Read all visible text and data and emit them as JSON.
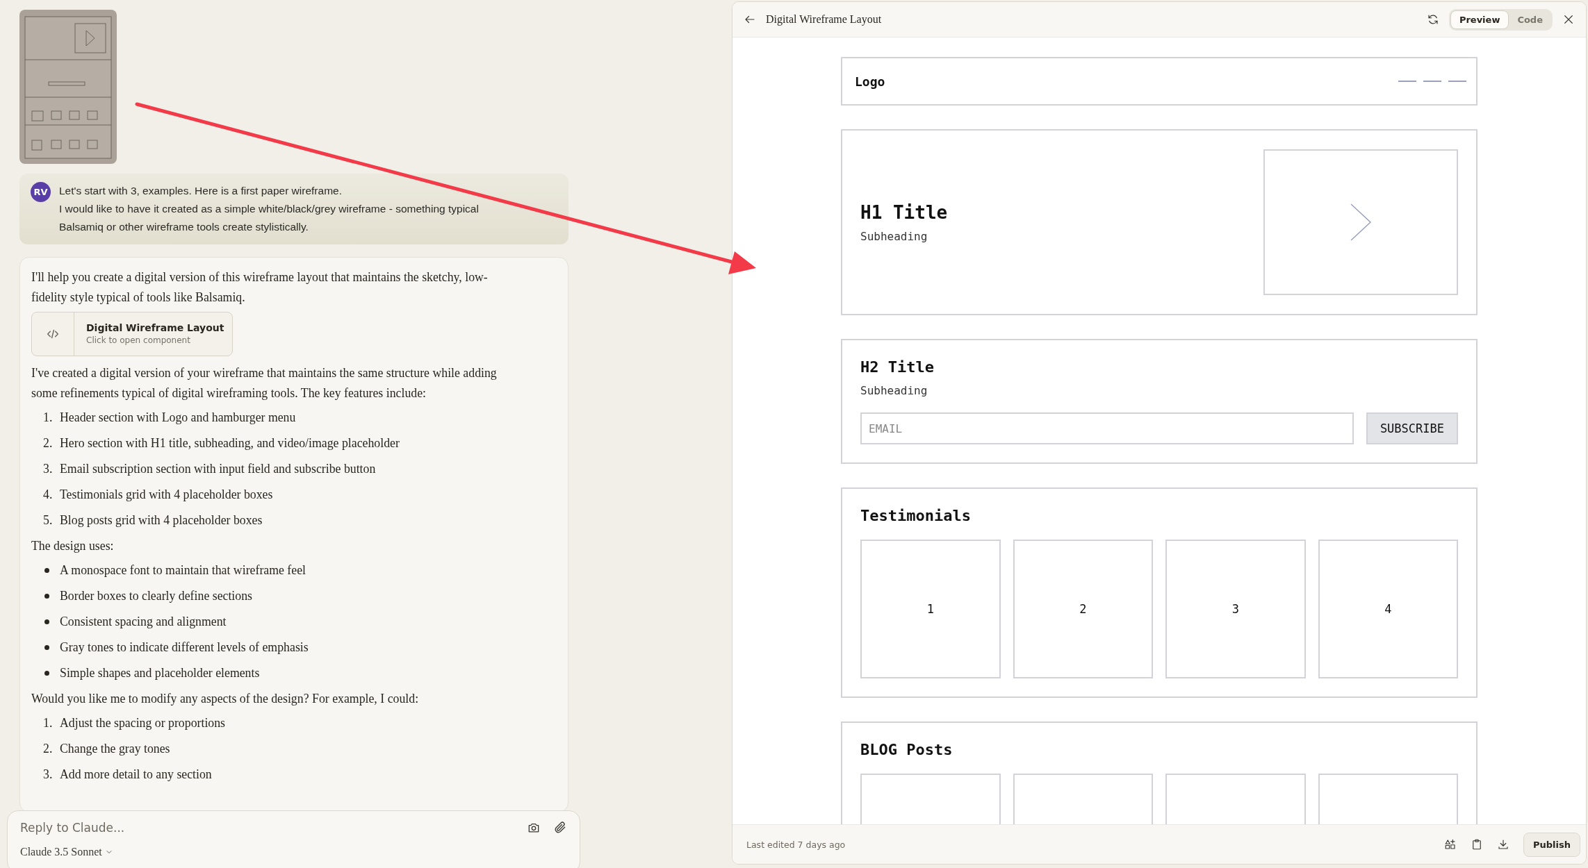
{
  "chat": {
    "user_message": {
      "avatar": "RV",
      "lines": [
        "Let's start with 3, examples. Here is a first paper wireframe.",
        "I would like to have it created as a simple white/black/grey wireframe - something typical",
        "Balsamiq or other wireframe tools create stylistically."
      ]
    },
    "assistant_message": {
      "intro": "I'll help you create a digital version of this wireframe layout that maintains the sketchy, low-fidelity style typical of tools like Balsamiq.",
      "artifact": {
        "title": "Digital Wireframe Layout",
        "subtitle": "Click to open component"
      },
      "paragraph": "I've created a digital version of your wireframe that maintains the same structure while adding some refinements typical of digital wireframing tools. The key features include:",
      "features": [
        {
          "number": "1.",
          "text": "Header section with Logo and hamburger menu"
        },
        {
          "number": "2.",
          "text": "Hero section with H1 title, subheading, and video/image placeholder"
        },
        {
          "number": "3.",
          "text": "Email subscription section with input field and subscribe button"
        },
        {
          "number": "4.",
          "text": "Testimonials grid with 4 placeholder boxes"
        },
        {
          "number": "5.",
          "text": "Blog posts grid with 4 placeholder boxes"
        }
      ],
      "design_heading": "The design uses:",
      "design_points": [
        "A monospace font to maintain that wireframe feel",
        "Border boxes to clearly define sections",
        "Consistent spacing and alignment",
        "Gray tones to indicate different levels of emphasis",
        "Simple shapes and placeholder elements"
      ],
      "question": "Would you like me to modify any aspects of the design? For example, I could:",
      "options": [
        {
          "number": "1.",
          "text": "Adjust the spacing or proportions"
        },
        {
          "number": "2.",
          "text": "Change the gray tones"
        },
        {
          "number": "3.",
          "text": "Add more detail to any section"
        }
      ]
    },
    "composer": {
      "placeholder": "Reply to Claude...",
      "model": "Claude 3.5 Sonnet"
    }
  },
  "artifact_panel": {
    "title": "Digital Wireframe Layout",
    "tabs": [
      {
        "label": "Preview",
        "selected": true
      },
      {
        "label": "Code",
        "selected": false
      }
    ],
    "wireframe": {
      "logo": "Logo",
      "hero": {
        "title": "H1 Title",
        "subheading": "Subheading"
      },
      "subscribe": {
        "title": "H2 Title",
        "subheading": "Subheading",
        "placeholder": "EMAIL",
        "button": "SUBSCRIBE"
      },
      "testimonials": {
        "title": "Testimonials",
        "items": [
          "1",
          "2",
          "3",
          "4"
        ]
      },
      "blog": {
        "title": "BLOG Posts"
      }
    },
    "footer": {
      "status": "Last edited 7 days ago",
      "publish": "Publish"
    }
  }
}
